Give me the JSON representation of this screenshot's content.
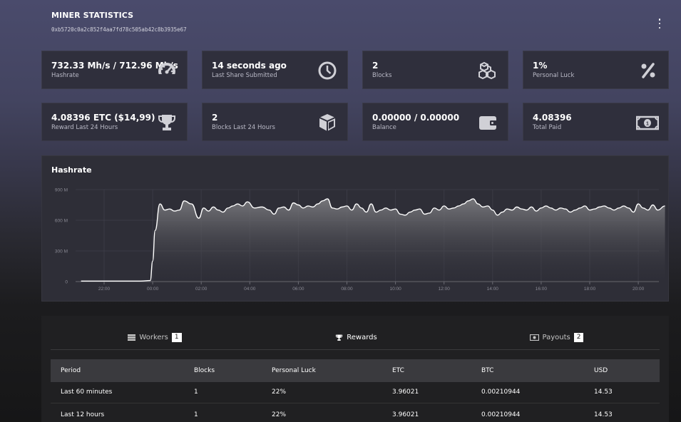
{
  "header": {
    "title": "MINER STATISTICS",
    "address": "0xb5720c0a2c852f4aa7fd78c505ab42c8b3935e67"
  },
  "stats": [
    {
      "value": "732.33 Mh/s / 712.96 Mh/s",
      "label": "Hashrate",
      "icon": "speedometer-icon"
    },
    {
      "value": "14 seconds ago",
      "label": "Last Share Submitted",
      "icon": "clock-icon"
    },
    {
      "value": "2",
      "label": "Blocks",
      "icon": "cubes-icon"
    },
    {
      "value": "1%",
      "label": "Personal Luck",
      "icon": "percent-icon"
    },
    {
      "value": "4.08396 ETC ($14,99)",
      "label": "Reward Last 24 Hours",
      "icon": "trophy-icon"
    },
    {
      "value": "2",
      "label": "Blocks Last 24 Hours",
      "icon": "cube-icon"
    },
    {
      "value": "0.00000 / 0.00000",
      "label": "Balance",
      "icon": "wallet-icon"
    },
    {
      "value": "4.08396",
      "label": "Total Paid",
      "icon": "money-bill-icon"
    }
  ],
  "chart_data": {
    "type": "area",
    "title": "Hashrate",
    "xlabel": "",
    "ylabel": "",
    "ylim": [
      0,
      900
    ],
    "yticks": [
      "0",
      "300 M",
      "600 M",
      "900 M"
    ],
    "xticks": [
      "22:00",
      "00:00",
      "02:00",
      "04:00",
      "06:00",
      "08:00",
      "10:00",
      "12:00",
      "14:00",
      "16:00",
      "18:00",
      "20:00"
    ],
    "grid": true,
    "series": [
      {
        "name": "",
        "x_hours": [
          -2.95,
          -2.0,
          -1.0,
          -0.5,
          -0.1,
          0.0,
          0.1,
          0.3,
          0.5,
          0.7,
          0.9,
          1.1,
          1.3,
          1.6,
          1.9,
          2.1,
          2.3,
          2.5,
          2.7,
          2.9,
          3.1,
          3.3,
          3.5,
          3.7,
          3.9,
          4.2,
          4.5,
          4.8,
          5.0,
          5.2,
          5.4,
          5.6,
          5.8,
          6.0,
          6.2,
          6.4,
          6.6,
          6.8,
          7.0,
          7.2,
          7.4,
          7.6,
          7.8,
          8.0,
          8.2,
          8.4,
          8.6,
          8.8,
          9.0,
          9.2,
          9.4,
          9.6,
          9.8,
          10.0,
          10.2,
          10.4,
          10.6,
          10.8,
          11.0,
          11.2,
          11.4,
          11.6,
          11.8,
          12.0,
          12.2,
          12.4,
          12.6,
          12.8,
          13.0,
          13.2,
          13.4,
          13.6,
          13.8,
          14.0,
          14.2,
          14.4,
          14.6,
          14.8,
          15.0,
          15.2,
          15.4,
          15.6,
          15.8,
          16.0,
          16.2,
          16.4,
          16.6,
          16.8,
          17.0,
          17.2,
          17.4,
          17.6,
          17.8,
          18.0,
          18.2,
          18.4,
          18.6,
          18.8,
          19.0,
          19.2,
          19.4,
          19.6,
          19.8,
          20.0,
          20.2,
          20.4,
          20.6,
          20.8,
          21.1
        ],
        "values": [
          5,
          5,
          5,
          5,
          10,
          200,
          500,
          760,
          700,
          710,
          690,
          700,
          790,
          760,
          620,
          720,
          690,
          730,
          700,
          680,
          720,
          740,
          760,
          740,
          780,
          720,
          730,
          700,
          660,
          720,
          730,
          700,
          770,
          750,
          720,
          740,
          730,
          760,
          790,
          810,
          720,
          710,
          730,
          740,
          700,
          760,
          720,
          680,
          760,
          680,
          700,
          720,
          700,
          710,
          660,
          650,
          680,
          700,
          710,
          660,
          670,
          720,
          700,
          740,
          710,
          720,
          740,
          760,
          790,
          810,
          760,
          730,
          740,
          700,
          650,
          680,
          710,
          700,
          730,
          710,
          700,
          730,
          690,
          720,
          740,
          720,
          700,
          720,
          710,
          680,
          700,
          720,
          740,
          700,
          710,
          730,
          740,
          720,
          700,
          720,
          740,
          720,
          680,
          760,
          720,
          700,
          750,
          700,
          740
        ]
      }
    ]
  },
  "tabs": [
    {
      "label": "Workers",
      "badge": "1",
      "icon": "server-icon"
    },
    {
      "label": "Rewards",
      "badge": "",
      "icon": "trophy-icon"
    },
    {
      "label": "Payouts",
      "badge": "2",
      "icon": "money-bill-icon"
    }
  ],
  "table": {
    "columns": [
      "Period",
      "Blocks",
      "Personal Luck",
      "ETC",
      "BTC",
      "USD"
    ],
    "rows": [
      [
        "Last 60 minutes",
        "1",
        "22%",
        "3.96021",
        "0.00210944",
        "14.53"
      ],
      [
        "Last 12 hours",
        "1",
        "22%",
        "3.96021",
        "0.00210944",
        "14.53"
      ]
    ]
  }
}
